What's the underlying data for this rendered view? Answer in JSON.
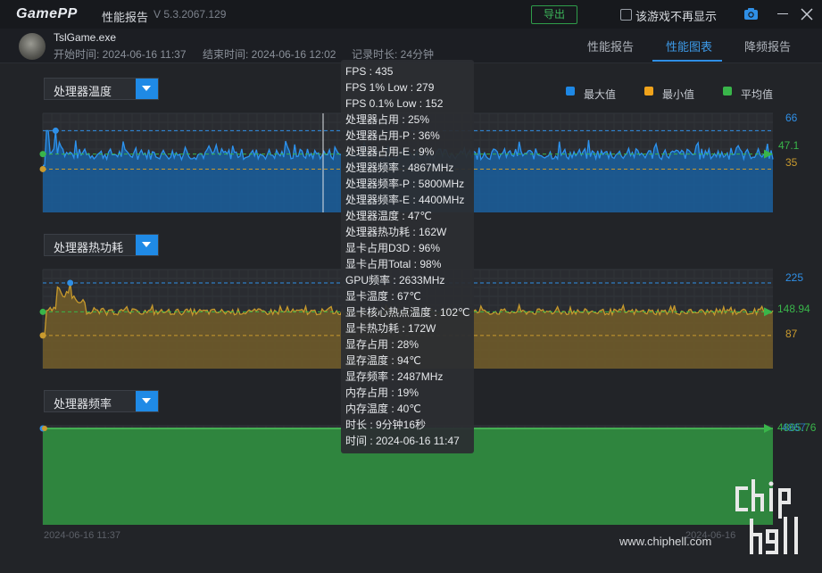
{
  "titlebar": {
    "logo": "GamePP",
    "report_label": "性能报告",
    "version": "V 5.3.2067.129",
    "export_label": "导出",
    "no_show_label": "该游戏不再显示"
  },
  "session": {
    "app_name": "TslGame.exe",
    "start_time": "开始时间: 2024-06-16 11:37",
    "end_time": "结束时间: 2024-06-16 12:02",
    "duration": "记录时长: 24分钟"
  },
  "tabs": [
    {
      "label": "性能报告",
      "active": false
    },
    {
      "label": "性能图表",
      "active": true
    },
    {
      "label": "降频报告",
      "active": false
    }
  ],
  "legend": [
    {
      "label": "最大值",
      "color": "#1e88e5"
    },
    {
      "label": "最小值",
      "color": "#f0a31b"
    },
    {
      "label": "平均值",
      "color": "#39b54a"
    }
  ],
  "charts": [
    {
      "dropdown": "处理器温度",
      "max_label": "66",
      "avg_label": "47.1",
      "min_label": "35"
    },
    {
      "dropdown": "处理器热功耗",
      "max_label": "225",
      "avg_label": "148.94",
      "min_label": "87"
    },
    {
      "dropdown": "处理器频率",
      "max_label": "4867",
      "avg_label": "4865.76",
      "min_label": ""
    }
  ],
  "chart_data": [
    {
      "type": "area",
      "title": "处理器温度",
      "ylim": [
        0,
        80
      ],
      "max": 66,
      "min": 35,
      "avg": 47.1,
      "color": "#1e88e5"
    },
    {
      "type": "area",
      "title": "处理器热功耗",
      "ylim": [
        0,
        260
      ],
      "max": 225,
      "min": 87,
      "avg": 148.94,
      "color": "#b8902a"
    },
    {
      "type": "area",
      "title": "处理器频率",
      "max": 4867,
      "avg": 4865.76,
      "color": "#3aa84a"
    }
  ],
  "tooltip": [
    "FPS : 435",
    "FPS 1% Low : 279",
    "FPS 0.1% Low : 152",
    "处理器占用 : 25%",
    "处理器占用-P : 36%",
    "处理器占用-E : 9%",
    "处理器频率 : 4867MHz",
    "处理器频率-P : 5800MHz",
    "处理器频率-E : 4400MHz",
    "处理器温度 : 47℃",
    "处理器热功耗 : 162W",
    "显卡占用D3D : 96%",
    "显卡占用Total : 98%",
    "GPU频率 : 2633MHz",
    "显卡温度 : 67℃",
    "显卡核心热点温度 : 102℃",
    "显卡热功耗 : 172W",
    "显存占用 : 28%",
    "显存温度 : 94℃",
    "显存频率 : 2487MHz",
    "内存占用 : 19%",
    "内存温度 : 40℃",
    "时长 : 9分钟16秒",
    "时间 : 2024-06-16 11:47"
  ],
  "footer": {
    "start_date": "2024-06-16 11:37",
    "end_date": "2024-06-16"
  },
  "watermark": {
    "url": "www.chiphell.com",
    "logo_text": "chip hell"
  }
}
